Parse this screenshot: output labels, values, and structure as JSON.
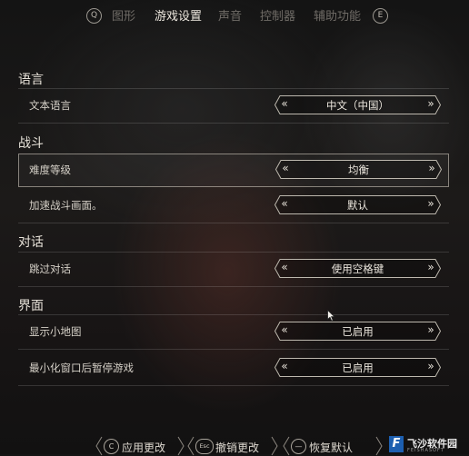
{
  "tabs": {
    "prev_key": "Q",
    "next_key": "E",
    "items": [
      {
        "label": "图形"
      },
      {
        "label": "游戏设置"
      },
      {
        "label": "声音"
      },
      {
        "label": "控制器"
      },
      {
        "label": "辅助功能"
      }
    ],
    "active_index": 1
  },
  "sections": {
    "language": {
      "title": "语言",
      "rows": [
        {
          "label": "文本语言",
          "value": "中文（中国）"
        }
      ]
    },
    "combat": {
      "title": "战斗",
      "rows": [
        {
          "label": "难度等级",
          "value": "均衡"
        },
        {
          "label": "加速战斗画面。",
          "value": "默认"
        }
      ]
    },
    "dialogue": {
      "title": "对话",
      "rows": [
        {
          "label": "跳过对话",
          "value": "使用空格键"
        }
      ]
    },
    "interface": {
      "title": "界面",
      "rows": [
        {
          "label": "显示小地图",
          "value": "已启用"
        },
        {
          "label": "最小化窗口后暂停游戏",
          "value": "已启用"
        }
      ]
    }
  },
  "selector_arrows": {
    "left": "«",
    "right": "»"
  },
  "bottom_bar": {
    "apply": {
      "key": "C",
      "label": "应用更改"
    },
    "revert": {
      "key": "Esc",
      "label": "撤销更改"
    },
    "reset": {
      "key": "—",
      "label": "恢复默认"
    }
  },
  "watermark": {
    "mark": "F",
    "text": "飞沙软件园",
    "subtext": "FEISHASOFT"
  },
  "colors": {
    "accent": "#ece7de",
    "muted_tab": "#6f6b66",
    "background": "#181616"
  }
}
